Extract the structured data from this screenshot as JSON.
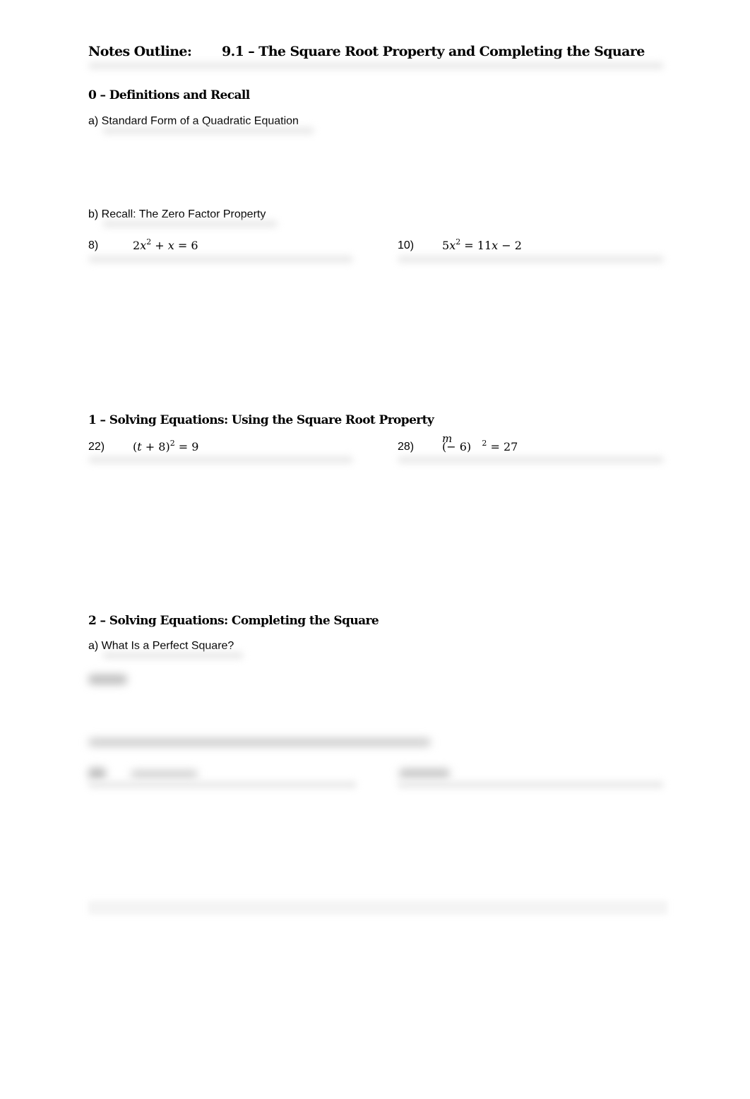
{
  "document": {
    "title_label": "Notes Outline:",
    "title_text": "9.1 – The Square Root Property and Completing the Square"
  },
  "section0": {
    "heading": "0 – Definitions and Recall",
    "item_a": "a) Standard Form of a Quadratic Equation",
    "item_b": "b) Recall: The Zero Factor Property",
    "problems": [
      {
        "number": "8)",
        "equation": "2x² + x = 6"
      },
      {
        "number": "10)",
        "equation": "5x² = 11x − 2"
      }
    ]
  },
  "section1": {
    "heading": "1 – Solving Equations: Using the Square Root Property",
    "problems": [
      {
        "number": "22)",
        "equation": "(t + 8)² = 9"
      },
      {
        "number": "28)",
        "equation": "(m − 6)² = 27"
      }
    ]
  },
  "section2": {
    "heading": "2 – Solving Equations: Completing the Square",
    "item_a": "a) What Is a Perfect Square?",
    "obscured_content": "blurred / not legible"
  }
}
